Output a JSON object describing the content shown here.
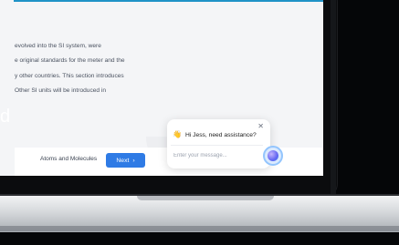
{
  "lesson": {
    "paragraph_lines": [
      "evolved into the SI system, were",
      "e original standards for the meter and the",
      "y other countries. This section introduces",
      "Other SI units will be introduced in"
    ],
    "left_fragment": "d",
    "footer": {
      "prev_label": "Atoms and Molecules",
      "next_label": "Next",
      "next_icon": "chevron-right-icon"
    }
  },
  "chat": {
    "greeting": "Hi Jess, need assistance?",
    "greeting_icon": "waving-hand-icon",
    "input_placeholder": "Enter your message...",
    "close_icon": "close-icon",
    "assistant_icon": "ai-assistant-orb-icon"
  },
  "colors": {
    "accent": "#2f7be5",
    "top_bar": "#1f93c7"
  }
}
